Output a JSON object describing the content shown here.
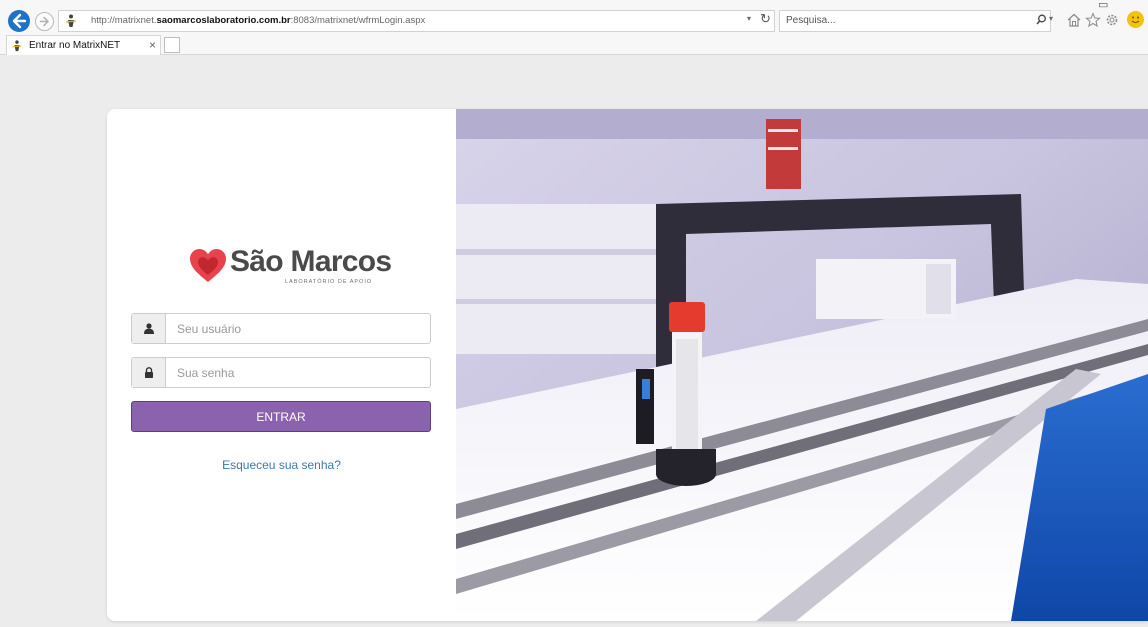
{
  "browser": {
    "url_prefix": "http://matrixnet.",
    "url_domain": "saomarcoslaboratorio.com.br",
    "url_suffix": ":8083/matrixnet/wfrmLogin.aspx",
    "search_placeholder": "Pesquisa...",
    "tab_title": "Entrar no MatrixNET",
    "tab_close": "×"
  },
  "brand": {
    "name": "São Marcos",
    "tagline": "LABORATÓRIO DE APOIO",
    "heart_color": "#e8424d"
  },
  "login": {
    "username_placeholder": "Seu usuário",
    "password_placeholder": "Sua senha",
    "submit_label": "ENTRAR",
    "forgot_label": "Esqueceu sua senha?",
    "button_color": "#8b62ad",
    "link_color": "#3a79b4"
  },
  "icons": {
    "user": "user-icon",
    "lock": "lock-icon",
    "back": "back-arrow-icon",
    "forward": "forward-arrow-icon"
  }
}
